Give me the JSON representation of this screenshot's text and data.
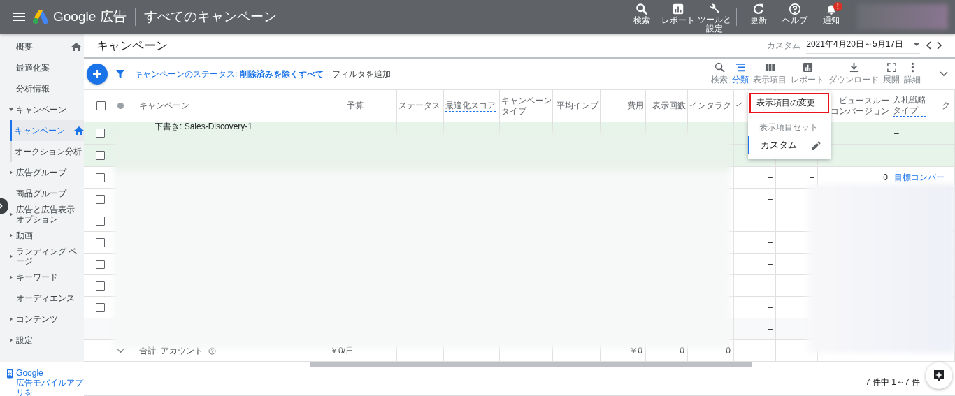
{
  "app_bar": {
    "brand": "Google 広告",
    "title": "すべてのキャンペーン",
    "actions": [
      {
        "label": "検索"
      },
      {
        "label": "レポート"
      },
      {
        "label": "ツールと設定"
      },
      {
        "label": "更新"
      },
      {
        "label": "ヘルプ"
      },
      {
        "label": "通知",
        "badge": "!"
      }
    ]
  },
  "sidebar": {
    "items": [
      {
        "label": "概要",
        "selected": false,
        "home": true
      },
      {
        "label": "最適化案",
        "selected": false,
        "home": false
      },
      {
        "label": "分析情報",
        "selected": false,
        "home": false
      },
      {
        "label": "キャンペーン",
        "selected": false,
        "home": false,
        "expanded": true,
        "children": [
          {
            "label": "キャンペーン",
            "selected": true,
            "home": true
          },
          {
            "label": "オークション分析",
            "selected": false,
            "home": false
          }
        ]
      },
      {
        "label": "広告グループ",
        "selected": false,
        "home": false,
        "expanded": false
      },
      {
        "label": "商品グループ",
        "selected": false,
        "home": false
      },
      {
        "label": "広告と広告表示オプション",
        "selected": false,
        "home": false,
        "expanded": false
      },
      {
        "label": "動画",
        "selected": false,
        "home": false,
        "expanded": false
      },
      {
        "label": "ランディング ページ",
        "selected": false,
        "home": false,
        "expanded": false
      },
      {
        "label": "キーワード",
        "selected": false,
        "home": false,
        "expanded": false
      },
      {
        "label": "オーディエンス",
        "selected": false,
        "home": false
      },
      {
        "label": "コンテンツ",
        "selected": false,
        "home": false,
        "expanded": false
      },
      {
        "label": "設定",
        "selected": false,
        "home": false,
        "expanded": false
      }
    ],
    "app_promo": {
      "line_1": "Google",
      "line_2": "広告モバイルアプリを"
    }
  },
  "page": {
    "title": "キャンペーン",
    "date_range": {
      "label": "カスタム",
      "value": "2021年4月20日～5月17日"
    }
  },
  "filter_bar": {
    "filter": "キャンペーンのステータス: **削除済みを除くすべて**",
    "add_filter": "フィルタを追加"
  },
  "tools": [
    {
      "label": "検索",
      "selected": false
    },
    {
      "label": "分類",
      "selected": true
    },
    {
      "label": "表示項目",
      "selected": false
    },
    {
      "label": "レポート",
      "selected": false
    },
    {
      "label": "ダウンロード",
      "selected": false
    },
    {
      "label": "展開",
      "selected": false
    },
    {
      "label": "詳細",
      "selected": false
    }
  ],
  "table": {
    "header_checked": false,
    "columns": [
      {},
      {},
      {
        "lines": [
          "キャンペーン"
        ],
        "hint": false
      },
      {
        "lines": [
          "予算"
        ],
        "hint": false
      },
      {
        "lines": [
          "ステータス"
        ],
        "hint": false
      },
      {
        "lines": [
          "最適化スコア"
        ],
        "hint": true
      },
      {
        "lines": [
          "キャンペーン",
          "タイプ"
        ],
        "hint": false
      },
      {
        "lines": [
          "平均インプ"
        ],
        "hint": false
      },
      {
        "lines": [
          "費用"
        ],
        "hint": false
      },
      {
        "lines": [
          "表示回数"
        ],
        "hint": false
      },
      {
        "lines": [
          "インタラク"
        ],
        "hint": false
      },
      {
        "lines": [
          "イ"
        ],
        "hint": false
      },
      {},
      {
        "lines": [
          "ビュースルー",
          "コンバージョン"
        ],
        "hint": false
      },
      {
        "lines": [
          "入札戦略",
          "タイプ"
        ],
        "hint": true
      },
      {
        "lines": [
          "ク"
        ],
        "hint": false
      }
    ],
    "rows": [
      {
        "kind": "draft",
        "checked": false,
        "cells": [
          null,
          null,
          "下書き: Sales-Discovery-1",
          null,
          null,
          null,
          null,
          null,
          null,
          null,
          null,
          null,
          null,
          null,
          "–",
          null
        ]
      },
      {
        "kind": "draft",
        "checked": false,
        "cells": [
          null,
          null,
          null,
          null,
          null,
          null,
          null,
          null,
          null,
          null,
          null,
          null,
          null,
          null,
          "–",
          null
        ]
      },
      {
        "kind": "normal",
        "checked": false,
        "cells": [
          null,
          null,
          null,
          null,
          null,
          null,
          null,
          null,
          null,
          null,
          null,
          "–",
          "–",
          "0",
          "目標コンバー",
          null
        ]
      },
      {
        "kind": "normal",
        "checked": false,
        "cells": [
          null,
          null,
          null,
          null,
          null,
          null,
          null,
          null,
          null,
          null,
          null,
          "–",
          null,
          null,
          null,
          null
        ]
      },
      {
        "kind": "normal",
        "checked": false,
        "cells": [
          null,
          null,
          null,
          null,
          null,
          null,
          null,
          null,
          null,
          null,
          null,
          "–",
          null,
          null,
          null,
          null
        ]
      },
      {
        "kind": "normal",
        "checked": false,
        "cells": [
          null,
          null,
          null,
          null,
          null,
          null,
          null,
          null,
          null,
          null,
          null,
          "–",
          null,
          null,
          null,
          null
        ]
      },
      {
        "kind": "normal",
        "checked": false,
        "cells": [
          null,
          null,
          null,
          null,
          null,
          null,
          null,
          null,
          null,
          null,
          null,
          "–",
          null,
          null,
          null,
          null
        ]
      },
      {
        "kind": "normal",
        "checked": false,
        "cells": [
          null,
          null,
          null,
          null,
          null,
          null,
          null,
          null,
          null,
          null,
          null,
          "–",
          null,
          null,
          null,
          null
        ]
      },
      {
        "kind": "normal",
        "checked": false,
        "cells": [
          null,
          null,
          null,
          null,
          null,
          null,
          null,
          null,
          null,
          null,
          null,
          "–",
          null,
          null,
          null,
          null
        ]
      },
      {
        "kind": "filler",
        "cells": [
          null,
          null,
          null,
          null,
          null,
          null,
          null,
          null,
          null,
          null,
          null,
          "–",
          null,
          null,
          null,
          null
        ]
      },
      {
        "kind": "total",
        "cells": [
          null,
          null,
          "合計: アカウント",
          "￥0/日",
          null,
          null,
          null,
          "–",
          "￥0",
          "0",
          "0",
          "–",
          null,
          null,
          null,
          null
        ]
      }
    ]
  },
  "column_menu": {
    "items": [
      {
        "label": "表示項目の変更",
        "highlighted": true
      }
    ],
    "section": "表示項目セット",
    "sets": [
      {
        "label": "カスタム",
        "selected": true
      }
    ]
  },
  "pagination": "7 件中 1～7 件"
}
